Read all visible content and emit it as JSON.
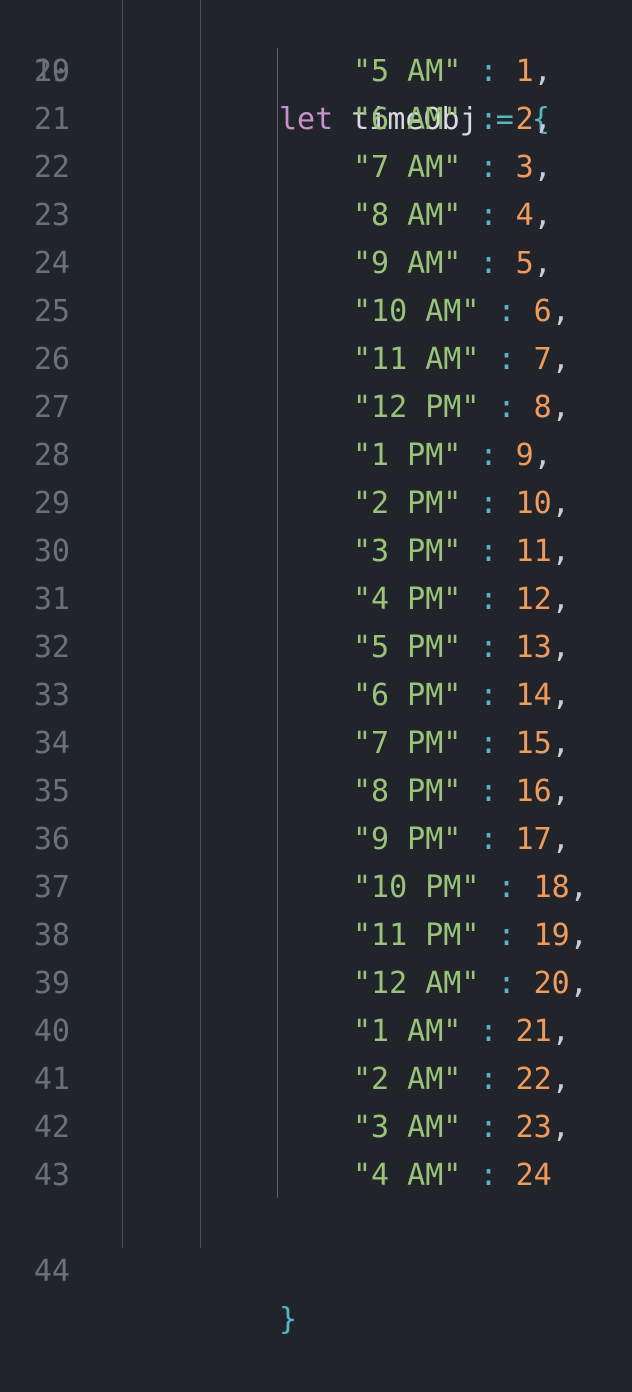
{
  "editor": {
    "colors": {
      "background": "#21252b",
      "keyword": "#c792c9",
      "string": "#98c379",
      "number": "#f09a5b",
      "operator": "#56b6c2",
      "line_number": "#6b717a"
    },
    "first_line": {
      "number": "19",
      "keyword": "let",
      "identifier": "timeObj",
      "operator": "=",
      "brace": "{"
    },
    "entries": [
      {
        "number": "20",
        "key": "\"5 AM\"",
        "value": "1",
        "comma": ","
      },
      {
        "number": "21",
        "key": "\"6 AM\"",
        "value": "2",
        "comma": ","
      },
      {
        "number": "22",
        "key": "\"7 AM\"",
        "value": "3",
        "comma": ","
      },
      {
        "number": "23",
        "key": "\"8 AM\"",
        "value": "4",
        "comma": ","
      },
      {
        "number": "24",
        "key": "\"9 AM\"",
        "value": "5",
        "comma": ","
      },
      {
        "number": "25",
        "key": "\"10 AM\"",
        "value": "6",
        "comma": ","
      },
      {
        "number": "26",
        "key": "\"11 AM\"",
        "value": "7",
        "comma": ","
      },
      {
        "number": "27",
        "key": "\"12 PM\"",
        "value": "8",
        "comma": ","
      },
      {
        "number": "28",
        "key": "\"1 PM\"",
        "value": "9",
        "comma": ","
      },
      {
        "number": "29",
        "key": "\"2 PM\"",
        "value": "10",
        "comma": ","
      },
      {
        "number": "30",
        "key": "\"3 PM\"",
        "value": "11",
        "comma": ","
      },
      {
        "number": "31",
        "key": "\"4 PM\"",
        "value": "12",
        "comma": ","
      },
      {
        "number": "32",
        "key": "\"5 PM\"",
        "value": "13",
        "comma": ","
      },
      {
        "number": "33",
        "key": "\"6 PM\"",
        "value": "14",
        "comma": ","
      },
      {
        "number": "34",
        "key": "\"7 PM\"",
        "value": "15",
        "comma": ","
      },
      {
        "number": "35",
        "key": "\"8 PM\"",
        "value": "16",
        "comma": ","
      },
      {
        "number": "36",
        "key": "\"9 PM\"",
        "value": "17",
        "comma": ","
      },
      {
        "number": "37",
        "key": "\"10 PM\"",
        "value": "18",
        "comma": ","
      },
      {
        "number": "38",
        "key": "\"11 PM\"",
        "value": "19",
        "comma": ","
      },
      {
        "number": "39",
        "key": "\"12 AM\"",
        "value": "20",
        "comma": ","
      },
      {
        "number": "40",
        "key": "\"1 AM\"",
        "value": "21",
        "comma": ","
      },
      {
        "number": "41",
        "key": "\"2 AM\"",
        "value": "22",
        "comma": ","
      },
      {
        "number": "42",
        "key": "\"3 AM\"",
        "value": "23",
        "comma": ","
      },
      {
        "number": "43",
        "key": "\"4 AM\"",
        "value": "24",
        "comma": ""
      }
    ],
    "last_line": {
      "number": "44",
      "brace": "}"
    },
    "separator": ":"
  }
}
